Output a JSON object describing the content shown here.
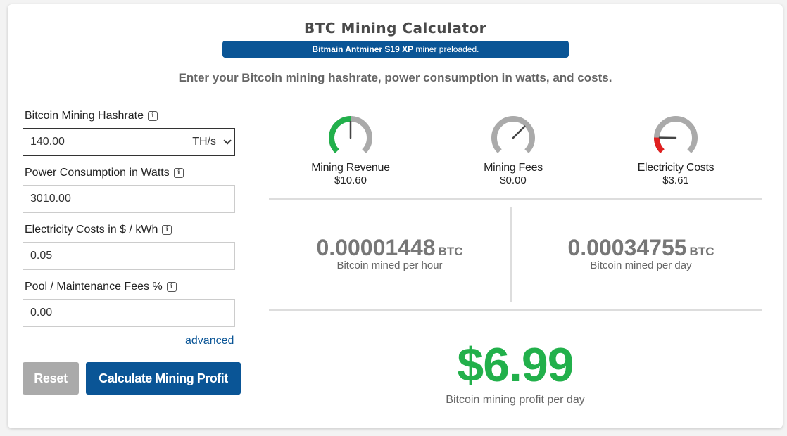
{
  "header": {
    "title": "BTC Mining Calculator",
    "banner_model": "Bitmain Antminer S19 XP",
    "banner_suffix": " miner preloaded.",
    "subtitle": "Enter your Bitcoin mining hashrate, power consumption in watts, and costs."
  },
  "form": {
    "hashrate": {
      "label": "Bitcoin Mining Hashrate",
      "value": "140.00",
      "unit": "TH/s"
    },
    "power": {
      "label": "Power Consumption in Watts",
      "value": "3010.00"
    },
    "electricity": {
      "label": "Electricity Costs in $ / kWh",
      "value": "0.05"
    },
    "fees": {
      "label": "Pool / Maintenance Fees %",
      "value": "0.00"
    },
    "advanced_label": "advanced",
    "reset_label": "Reset",
    "calculate_label": "Calculate Mining Profit"
  },
  "gauges": [
    {
      "label": "Mining Revenue",
      "value": "$10.60",
      "color": "#22b04b",
      "fill": 0.5
    },
    {
      "label": "Mining Fees",
      "value": "$0.00",
      "color": "#aaaaaa",
      "fill": 0.0
    },
    {
      "label": "Electricity Costs",
      "value": "$3.61",
      "color": "#e02020",
      "fill": 0.17
    }
  ],
  "stats": {
    "per_hour": {
      "value": "0.00001448",
      "currency": "BTC",
      "desc": "Bitcoin mined per hour"
    },
    "per_day": {
      "value": "0.00034755",
      "currency": "BTC",
      "desc": "Bitcoin mined per day"
    }
  },
  "profit": {
    "value": "$6.99",
    "desc": "Bitcoin mining profit per day"
  },
  "colors": {
    "accent": "#0a5596",
    "profit": "#22b04b",
    "reset": "#aaaaaa"
  }
}
